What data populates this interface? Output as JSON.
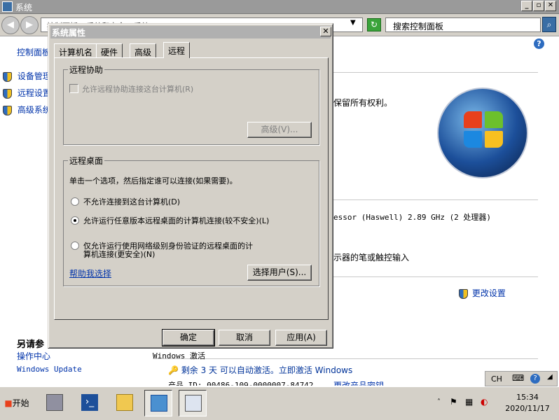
{
  "background_window": {
    "title": "系统",
    "address": "控制面板 ▸ 系统和安全 ▸ 系统",
    "search_placeholder": "搜索控制面板",
    "sidebar": {
      "home": "控制面板",
      "items": [
        {
          "label": "设备管理"
        },
        {
          "label": "远程设置"
        },
        {
          "label": "高级系统"
        }
      ],
      "see_also_title": "另请参",
      "see_also_items": [
        "操作中心",
        "Windows Update"
      ]
    },
    "main": {
      "rights": "保留所有权利。",
      "processor": "essor (Haswell)   2.89 GHz  (2 处理器)",
      "pen": "示器的笔或触控输入",
      "change_settings": "更改设置",
      "activation_header": "Windows 激活",
      "activation_msg": "剩余 3 天 可以自动激活。立即激活 Windows",
      "product_id": "产品 ID: 00486-109-0000007-84742",
      "change_key": "更改产品密钥"
    }
  },
  "dialog": {
    "title": "系统属性",
    "tabs": [
      "计算机名",
      "硬件",
      "高级",
      "远程"
    ],
    "remote_assist": {
      "label": "远程协助",
      "checkbox": "允许远程协助连接这台计算机(R)",
      "advanced_btn": "高级(V)..."
    },
    "remote_desktop": {
      "label": "远程桌面",
      "instruction": "单击一个选项，然后指定谁可以连接(如果需要)。",
      "opt1": "不允许连接到这台计算机(D)",
      "opt2": "允许运行任意版本远程桌面的计算机连接(较不安全)(L)",
      "opt3_line1": "仅允许运行使用网络级别身份验证的远程桌面的计",
      "opt3_line2": "算机连接(更安全)(N)",
      "help_link": "帮助我选择",
      "select_users_btn": "选择用户(S)..."
    },
    "buttons": {
      "ok": "确定",
      "cancel": "取消",
      "apply": "应用(A)"
    }
  },
  "taskbar": {
    "start": "开始",
    "lang": "CH",
    "time": "15:34",
    "date": "2020/11/17"
  }
}
